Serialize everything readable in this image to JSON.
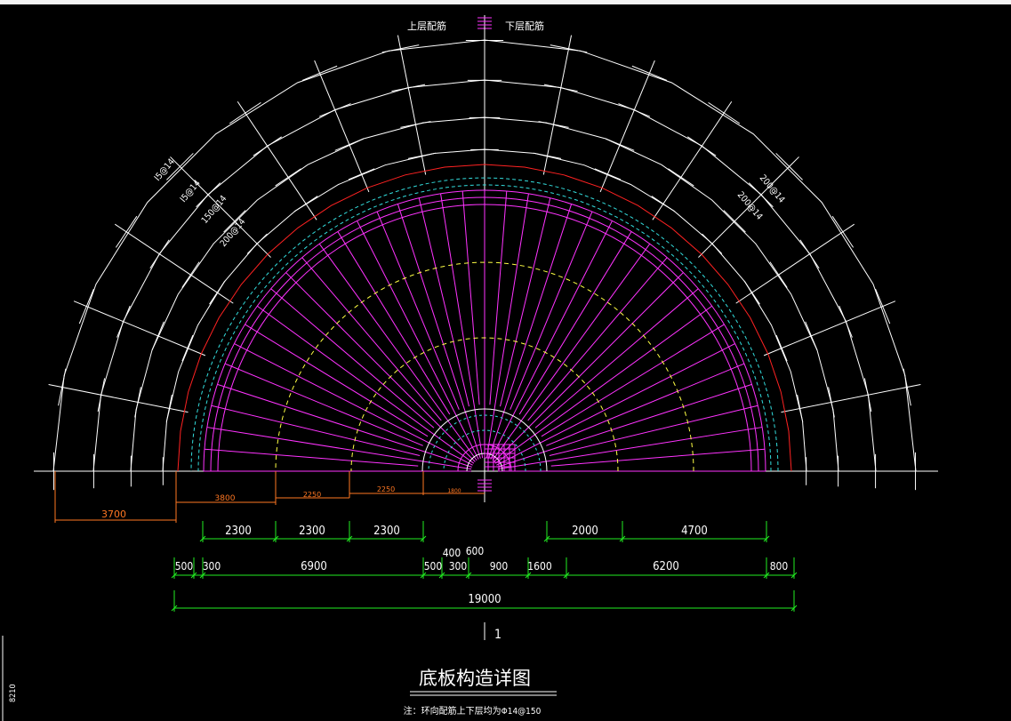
{
  "top_labels": {
    "upper": "上层配筋",
    "lower": "下层配筋"
  },
  "rebar_labels": {
    "left_outer": "Ⅰ5@14",
    "left_2": "Ⅰ5@14",
    "left_3": "150@14",
    "left_4": "200@14",
    "right_outer": "200@14",
    "right_inner": "200@14"
  },
  "orange_dims": {
    "d1": "3700",
    "d2": "3800",
    "d3": "2250",
    "d4": "2250",
    "d5": "1800"
  },
  "dim_row1": [
    "2300",
    "2300",
    "2300",
    "2000",
    "4700"
  ],
  "dim_row2": [
    "500",
    "300",
    "6900",
    "500",
    "300",
    "900",
    "1600",
    "6200",
    "800"
  ],
  "dim_row2_upper": [
    "400",
    "600"
  ],
  "dim_total": "19000",
  "section_mark": "1",
  "title": "底板构造详图",
  "note": "注：环向配筋上下层均为Φ14@150",
  "side_tag": "8210",
  "colors": {
    "white": "#ffffff",
    "magenta": "#ff33ff",
    "red": "#ff2222",
    "cyan": "#33dddd",
    "yellow": "#ffff44",
    "orange": "#ff7722",
    "green": "#22ee22"
  }
}
